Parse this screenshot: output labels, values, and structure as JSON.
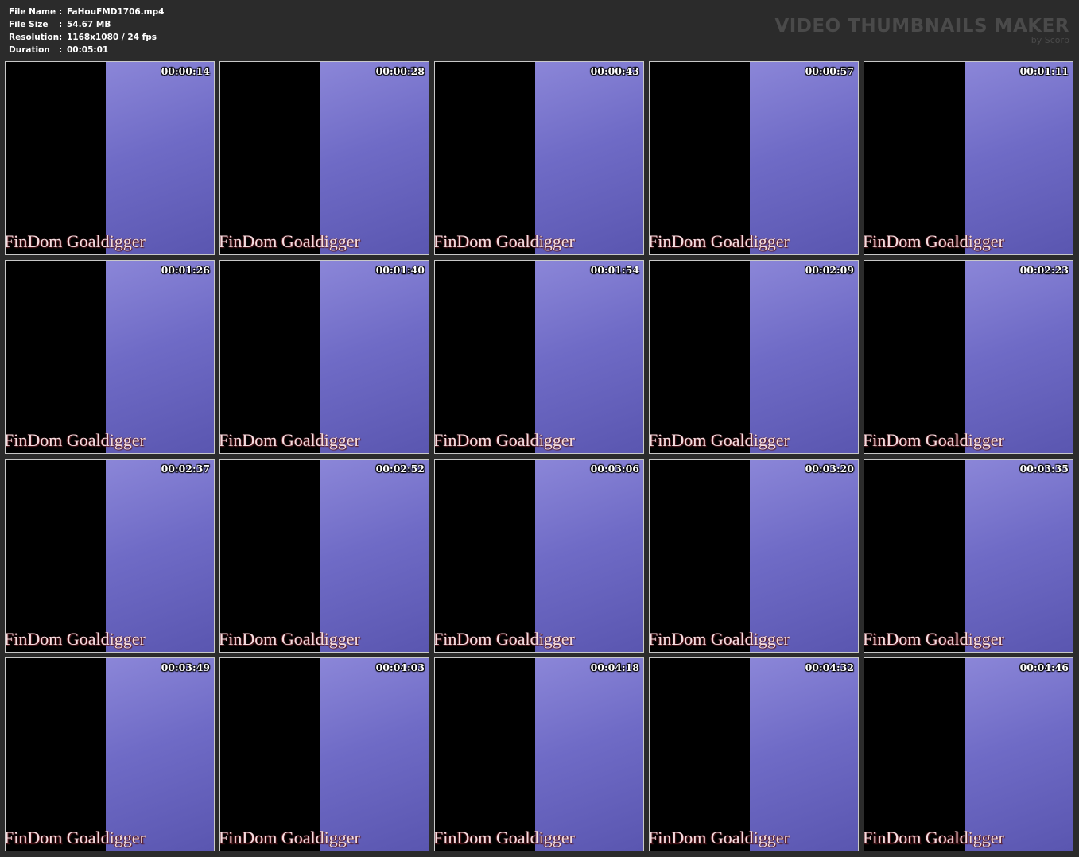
{
  "info": {
    "rows": [
      {
        "label": "File Name",
        "colon": ":",
        "value": "FaHouFMD1706.mp4"
      },
      {
        "label": "File Size",
        "colon": ":",
        "value": "54.67 MB"
      },
      {
        "label": "Resolution",
        "colon": ":",
        "value": "1168x1080 / 24 fps"
      },
      {
        "label": "Duration",
        "colon": ":",
        "value": "00:05:01"
      }
    ]
  },
  "brand": {
    "title": "VIDEO THUMBNAILS MAKER",
    "subtitle": "by Scorp"
  },
  "thumbnails": [
    {
      "timestamp": "00:00:14",
      "watermark": "FinDom Goaldigger"
    },
    {
      "timestamp": "00:00:28",
      "watermark": "FinDom Goaldigger"
    },
    {
      "timestamp": "00:00:43",
      "watermark": "FinDom Goaldigger"
    },
    {
      "timestamp": "00:00:57",
      "watermark": "FinDom Goaldigger"
    },
    {
      "timestamp": "00:01:11",
      "watermark": "FinDom Goaldigger"
    },
    {
      "timestamp": "00:01:26",
      "watermark": "FinDom Goaldigger"
    },
    {
      "timestamp": "00:01:40",
      "watermark": "FinDom Goaldigger"
    },
    {
      "timestamp": "00:01:54",
      "watermark": "FinDom Goaldigger"
    },
    {
      "timestamp": "00:02:09",
      "watermark": "FinDom Goaldigger"
    },
    {
      "timestamp": "00:02:23",
      "watermark": "FinDom Goaldigger"
    },
    {
      "timestamp": "00:02:37",
      "watermark": "FinDom Goaldigger"
    },
    {
      "timestamp": "00:02:52",
      "watermark": "FinDom Goaldigger"
    },
    {
      "timestamp": "00:03:06",
      "watermark": "FinDom Goaldigger"
    },
    {
      "timestamp": "00:03:20",
      "watermark": "FinDom Goaldigger"
    },
    {
      "timestamp": "00:03:35",
      "watermark": "FinDom Goaldigger"
    },
    {
      "timestamp": "00:03:49",
      "watermark": "FinDom Goaldigger"
    },
    {
      "timestamp": "00:04:03",
      "watermark": "FinDom Goaldigger"
    },
    {
      "timestamp": "00:04:18",
      "watermark": "FinDom Goaldigger"
    },
    {
      "timestamp": "00:04:32",
      "watermark": "FinDom Goaldigger"
    },
    {
      "timestamp": "00:04:46",
      "watermark": "FinDom Goaldigger"
    }
  ],
  "colors": {
    "background": "#2b2b2b",
    "brand_text": "#4a4a4a",
    "thumb_border": "#c8c8c8",
    "watermark": "#f4dde0"
  }
}
